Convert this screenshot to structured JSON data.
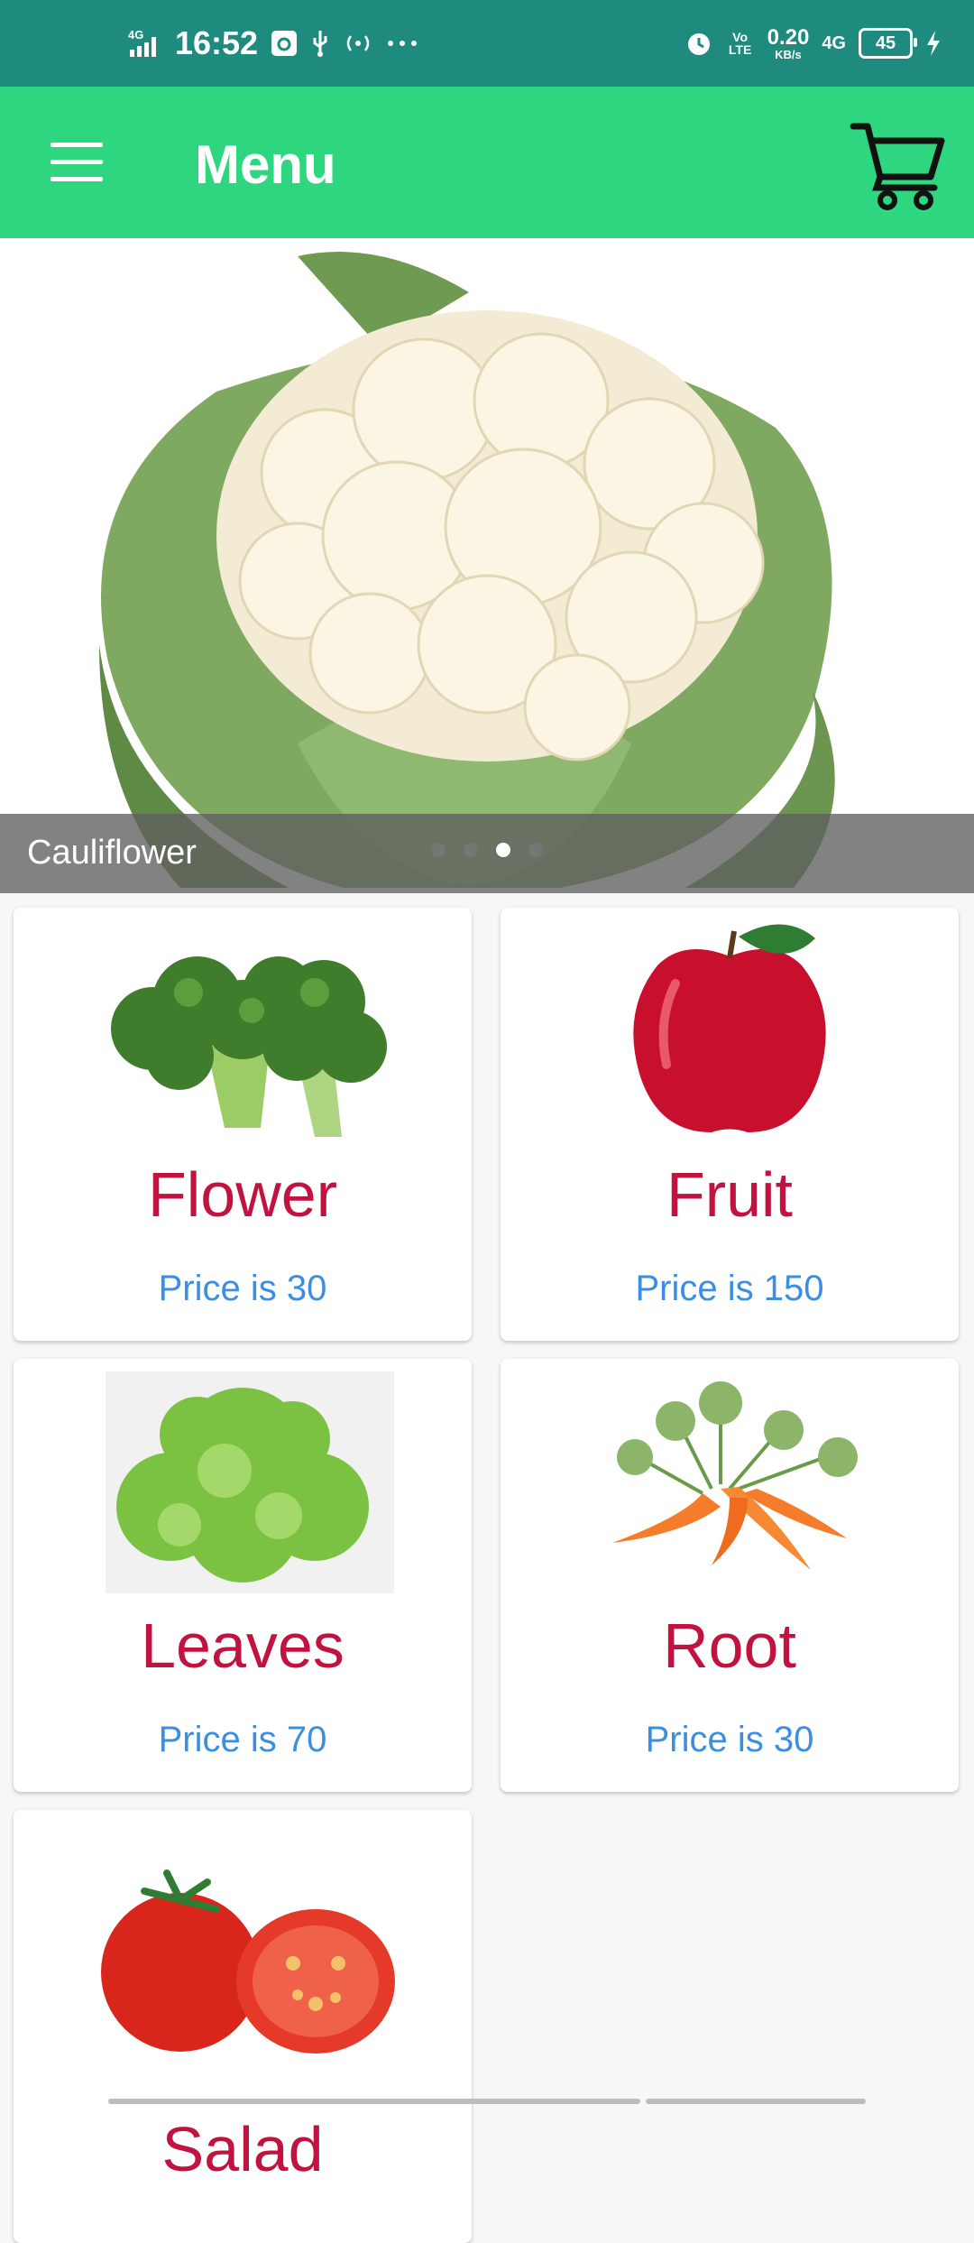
{
  "status_bar": {
    "time": "16:52",
    "network_left": "4G",
    "volte": "Vo LTE",
    "speed_value": "0.20",
    "speed_unit": "KB/s",
    "network_right": "4G",
    "battery": "45",
    "icons": [
      "signal-icon",
      "settings-notification-icon",
      "usb-icon",
      "hotspot-icon",
      "more-dots-icon",
      "alarm-icon",
      "charging-icon"
    ]
  },
  "app_bar": {
    "title": "Menu",
    "color": "#2fd680"
  },
  "banner": {
    "caption": "Cauliflower",
    "slide_count": 4,
    "active_slide": 3
  },
  "items": [
    {
      "name": "Flower",
      "price": "Price is 30",
      "image": "broccoli-image"
    },
    {
      "name": "Fruit",
      "price": "Price is 150",
      "image": "apple-image"
    },
    {
      "name": "Leaves",
      "price": "Price is 70",
      "image": "lettuce-image"
    },
    {
      "name": "Root",
      "price": "Price is 30",
      "image": "carrot-image"
    },
    {
      "name": "Salad",
      "price": "",
      "image": "tomato-image"
    }
  ],
  "colors": {
    "status_bar": "#1f8a7e",
    "title_text": "#c2123f",
    "price_text": "#3b8ee0"
  }
}
